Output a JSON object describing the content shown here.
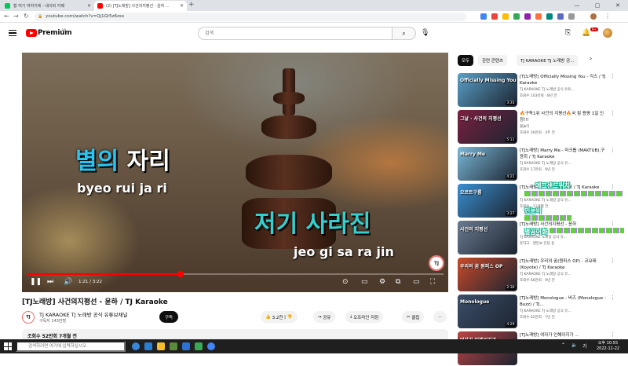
{
  "browser": {
    "tabs": [
      {
        "label": "황 여기 여하키에 - 네이버 카페",
        "favicon_color": "#03c75a"
      },
      {
        "label": "(2) [TJ노래방] 사건의지평선 - 윤하 ...",
        "favicon_color": "#ff0000"
      }
    ],
    "new_tab": "+",
    "window_controls": {
      "minimize": "—",
      "maximize": "▢",
      "close": "✕"
    },
    "url": "youtube.com/watch?v=Qj1Gt5z6zso"
  },
  "header": {
    "brand": "Premium",
    "country": "KR",
    "search_placeholder": "검색",
    "notification_count": "9+"
  },
  "player": {
    "lyric1_highlight": "별의",
    "lyric1_rest": " 자리",
    "romanization1": "byeo rui  ja ri",
    "lyric2": "저기 사라진",
    "romanization2": "jeo gi  sa ra jin",
    "watermark": "TJ",
    "time": "1:21 / 3:22",
    "progress_fraction": 0.37,
    "progress_color": "#ff0000"
  },
  "video": {
    "title": "[TJ노래방] 사건의지평선 - 윤하 / TJ Karaoke",
    "channel": "TJ KARAOKE TJ 노래방 공식 유튜브채널",
    "subscribers": "구독자 143만명",
    "subscribe": "구독",
    "likes": "3.2천",
    "share": "공유",
    "offline": "오프라인 저장",
    "clip": "클립",
    "more": "···",
    "description": "조회수 52만회  7개월 전"
  },
  "sidebar": {
    "chips": [
      "모두",
      "관련 콘텐츠",
      "TJ KARAOKE TJ 노래방 공..."
    ],
    "recs": [
      {
        "title": "[TJ노래방] Officially Missing You - 긱스 / TJ Karaoke",
        "channel": "TJ KARAOKE TJ 노래방 공식 유튜...",
        "meta": "조회수 103만회 · 8년 전",
        "duration": "3:33",
        "thumb_text": "Officially Missing You",
        "thumb_color": "#5aa0c8"
      },
      {
        "title": "🔥구독1위 사건의 지평선🔥국 힘 용평 1일 인정!!!",
        "channel": "불놀이",
        "meta": "조회수 30만회 · 3주 전",
        "duration": "5:11",
        "thumb_text": "그날 · 사건의 지평선",
        "thumb_color": "#7a2040"
      },
      {
        "title": "[TJ노래방] Marry Me - 마크툽 (MAKTUB),구윤회 / TJ Karaoke",
        "channel": "TJ KARAOKE TJ 노래방 공식 유...",
        "meta": "조회수 17만회 · 9년 전",
        "duration": "4:21",
        "thumb_text": "Marry Me",
        "thumb_color": "#7ab8d8"
      },
      {
        "title": "[TJ노래방] 오르트구름 - 윤하 / TJ Karaoke",
        "channel": "TJ KARAOKE TJ 노래방 공식 유...",
        "meta": "조회수 · 11개월 전",
        "duration": "3:27",
        "thumb_text": "오르트구름",
        "thumb_color": "#3a8fd0"
      },
      {
        "title": "[TJ노래방] 사건의지평선 - 윤하",
        "channel": "TJ KARAOKE 노래방 공식 유...",
        "meta": "혼자고 · 랜턴쇼 인당 등",
        "duration": "",
        "thumb_text": "사건의 지평선",
        "thumb_color": "#6a7a90"
      },
      {
        "title": "[TJ노래방] 우리의 꿈(원피스 OP) - 코요태(Koyote) / TJ Karaoke",
        "channel": "TJ KARAOKE TJ 노래방 공식 유...",
        "meta": "조회수 66만회 · 9년 전",
        "duration": "2:36",
        "thumb_text": "우리의 꿈 원피스 OP",
        "thumb_color": "#c84a2a"
      },
      {
        "title": "[TJ노래방] Monologue - 버즈 (Monologue - Buzz) / TJ...",
        "channel": "TJ KARAOKE TJ 노래방 공식 유...",
        "meta": "조회수 62만회 · 7년 전",
        "duration": "4:29",
        "thumb_text": "Monologue",
        "thumb_color": "#3c4e6a"
      },
      {
        "title": "[TJ노래방] 여자가 인해이지가 ...",
        "channel": "",
        "meta": "",
        "duration": "",
        "thumb_text": "여자가 인해이지가",
        "thumb_color": "#b44"
      }
    ]
  },
  "overlays": {
    "comment1": "에그샌드위치",
    "comment2": "민눈비",
    "comment3": "별공어화"
  },
  "taskbar": {
    "search_placeholder": "검색하려면 여기에 입력하십시오.",
    "time": "오후 10:55",
    "date": "2022-11-22"
  }
}
